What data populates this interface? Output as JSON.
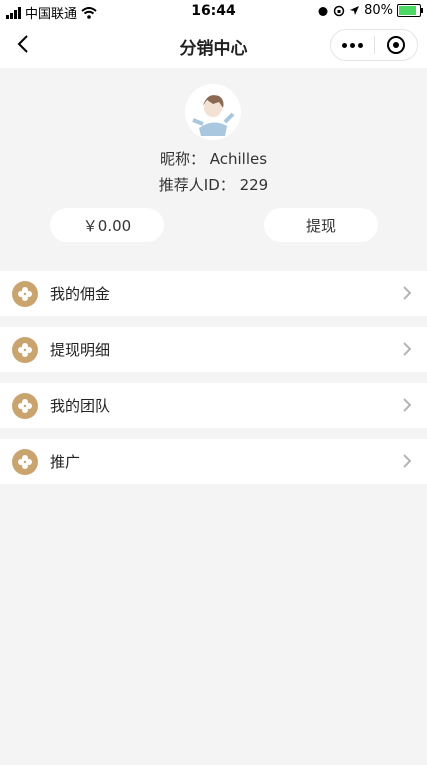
{
  "status": {
    "carrier": "中国联通",
    "time": "16:44",
    "battery": "80%"
  },
  "nav": {
    "title": "分销中心"
  },
  "profile": {
    "nickname_label": "昵称：",
    "nickname": "Achilles",
    "referrer_label": "推荐人ID：",
    "referrer_id": "229",
    "balance": "￥0.00",
    "withdraw_label": "提现"
  },
  "menu": [
    {
      "label": "我的佣金"
    },
    {
      "label": "提现明细"
    },
    {
      "label": "我的团队"
    },
    {
      "label": "推广"
    }
  ],
  "colors": {
    "menu_icon": "#c9a46f",
    "page_bg": "#f4f4f4"
  }
}
